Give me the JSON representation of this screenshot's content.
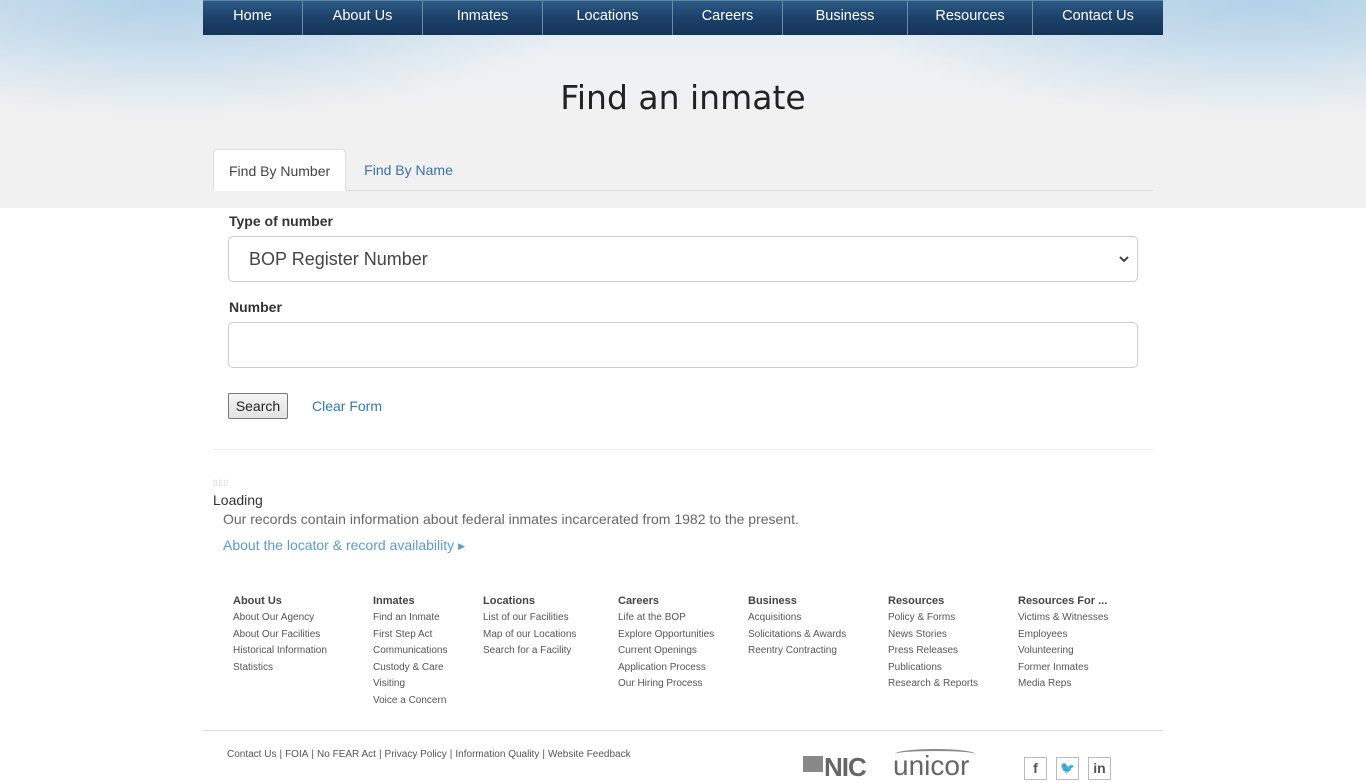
{
  "nav": {
    "items": [
      {
        "label": "Home"
      },
      {
        "label": "About Us"
      },
      {
        "label": "Inmates"
      },
      {
        "label": "Locations"
      },
      {
        "label": "Careers"
      },
      {
        "label": "Business"
      },
      {
        "label": "Resources"
      },
      {
        "label": "Contact Us"
      }
    ]
  },
  "page": {
    "title": "Find an inmate"
  },
  "tabs": [
    {
      "label": "Find By Number",
      "active": true
    },
    {
      "label": "Find By Name",
      "active": false
    }
  ],
  "form": {
    "type_label": "Type of number",
    "type_value": "BOP Register Number",
    "number_label": "Number",
    "number_value": "",
    "search_label": "Search",
    "clear_label": "Clear Form"
  },
  "status": {
    "spinner": "▯▯▯",
    "loading": "Loading",
    "records_note": "Our records contain information about federal inmates incarcerated from 1982 to the present.",
    "about_link": "About the locator & record availability"
  },
  "footer": {
    "columns": [
      {
        "heading": "About Us",
        "links": [
          "About Our Agency",
          "About Our Facilities",
          "Historical Information",
          "Statistics"
        ]
      },
      {
        "heading": "Inmates",
        "links": [
          "Find an Inmate",
          "First Step Act",
          "Communications",
          "Custody & Care",
          "Visiting",
          "Voice a Concern"
        ]
      },
      {
        "heading": "Locations",
        "links": [
          "List of our Facilities",
          "Map of our Locations",
          "Search for a Facility"
        ]
      },
      {
        "heading": "Careers",
        "links": [
          "Life at the BOP",
          "Explore Opportunities",
          "Current Openings",
          "Application Process",
          "Our Hiring Process"
        ]
      },
      {
        "heading": "Business",
        "links": [
          "Acquisitions",
          "Solicitations & Awards",
          "Reentry Contracting"
        ]
      },
      {
        "heading": "Resources",
        "links": [
          "Policy & Forms",
          "News Stories",
          "Press Releases",
          "Publications",
          "Research & Reports"
        ]
      },
      {
        "heading": "Resources For ...",
        "links": [
          "Victims & Witnesses",
          "Employees",
          "Volunteering",
          "Former Inmates",
          "Media Reps"
        ]
      }
    ],
    "legal": [
      "Contact Us",
      "FOIA",
      "No FEAR Act",
      "Privacy Policy",
      "Information Quality",
      "Website Feedback"
    ],
    "logos": {
      "nic": "NIC",
      "unicor": "unicor"
    },
    "social": [
      {
        "icon": "facebook-icon",
        "glyph": "f"
      },
      {
        "icon": "twitter-icon",
        "glyph": "🐦"
      },
      {
        "icon": "linkedin-icon",
        "glyph": "in"
      }
    ]
  },
  "colors": {
    "nav_dark": "#143459",
    "link_blue": "#2e7bb4",
    "tab_link": "#3a70a8"
  }
}
